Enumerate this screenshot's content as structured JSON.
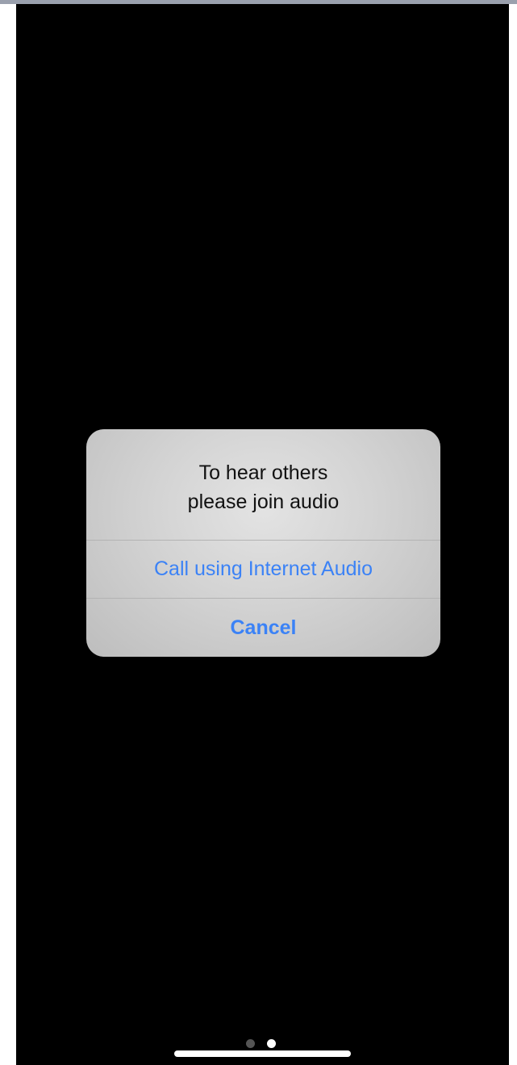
{
  "alert": {
    "message_line1": "To hear others",
    "message_line2": "please join audio",
    "primary_action": "Call using Internet Audio",
    "cancel_action": "Cancel"
  },
  "page_indicator": {
    "total_pages": 2,
    "current_page": 2
  },
  "colors": {
    "screen_background": "#000000",
    "alert_background": "#d3d3d3",
    "action_text": "#3b82f6",
    "message_text": "#111111"
  }
}
